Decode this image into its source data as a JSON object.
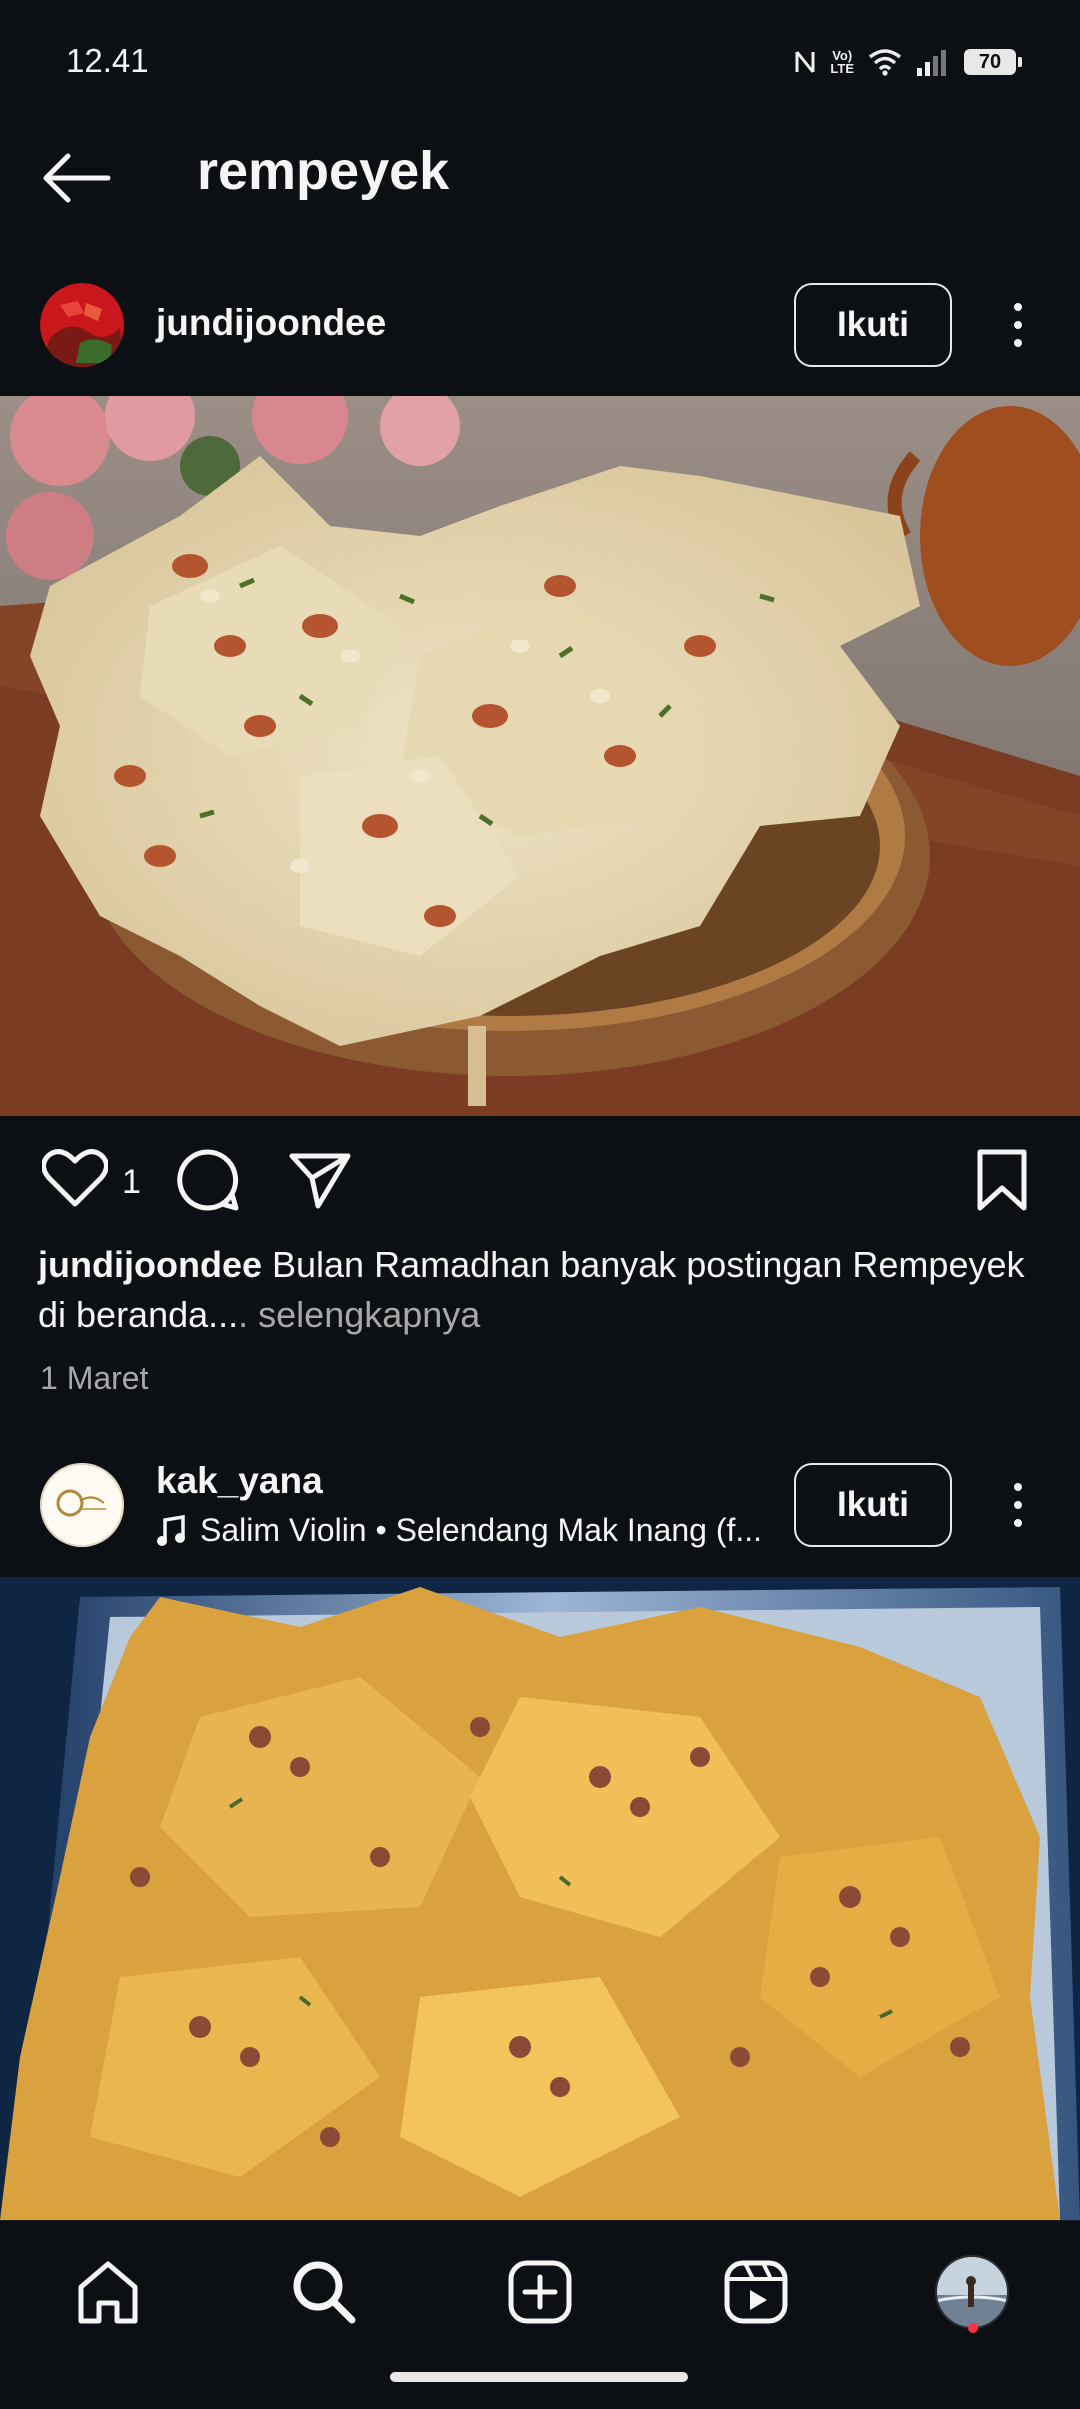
{
  "status_bar": {
    "time": "12.41",
    "battery": "70",
    "lte_label": "LTE",
    "volte_label": "Vo)"
  },
  "header": {
    "title": "rempeyek",
    "back_icon": "arrow-left-icon"
  },
  "posts": [
    {
      "username": "jundijoondee",
      "follow_label": "Ikuti",
      "like_count": "1",
      "caption_username": "jundijoondee",
      "caption_text": "Bulan Ramadhan banyak postingan Rempeyek di beranda...",
      "caption_more": ". selengkapnya",
      "date": "1 Maret"
    },
    {
      "username": "kak_yana",
      "follow_label": "Ikuti",
      "music": "Salim Violin • Selendang Mak Inang (f..."
    }
  ],
  "nav": {
    "items": [
      "home-icon",
      "search-icon",
      "create-icon",
      "reels-icon",
      "profile-avatar"
    ]
  },
  "colors": {
    "background": "#0c1014",
    "text": "#f5f5f5",
    "muted": "#a8a8a8",
    "notification": "#ff3040"
  }
}
